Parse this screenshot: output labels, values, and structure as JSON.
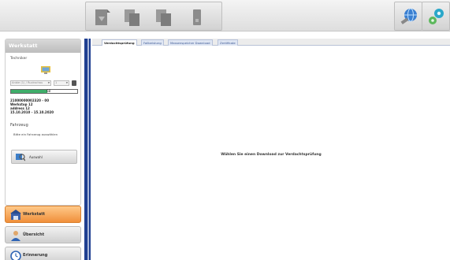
{
  "toolbar": {
    "buttons": [
      {
        "name": "download-icon"
      },
      {
        "name": "copy-icon"
      },
      {
        "name": "copy-alt-icon"
      },
      {
        "name": "card-icon"
      }
    ],
    "right_buttons": [
      {
        "name": "globe-connect-icon"
      },
      {
        "name": "settings-gears-icon"
      }
    ]
  },
  "werkstatt": {
    "title": "Werkstatt",
    "techniker_label": "Techniker",
    "dropdown1": "Anbie (1) / Ruckschau",
    "dropdown2": "1",
    "progress_percent": 55,
    "progress_text": "68",
    "info_lines": [
      "21000000002320 - 00",
      "Werkstop 12",
      "address 12",
      "15.10.2010 - 15.10.2020"
    ],
    "fahrzeug_label": "Fahrzeug",
    "fahrzeug_hint": "Bitte ein Fahrzeug auswählen",
    "auswahl_label": "Auswahl"
  },
  "nav": {
    "items": [
      {
        "label": "Werkstatt",
        "icon": "workshop-icon",
        "active": true
      },
      {
        "label": "Übersicht",
        "icon": "person-icon",
        "active": false
      },
      {
        "label": "Erinnerung",
        "icon": "clock-icon",
        "active": false
      }
    ]
  },
  "tabs": [
    {
      "label": "Verdachtsprüfung",
      "active": true
    },
    {
      "label": "Fallbeistung",
      "active": false
    },
    {
      "label": "Massenspeicher Download",
      "active": false
    },
    {
      "label": "Zertifikate",
      "active": false
    }
  ],
  "main": {
    "message": "Wählen Sie einen Download zur Verdachtsprüfung"
  },
  "colors": {
    "accent_blue": "#1f3f91",
    "active_nav": "#f08f3a",
    "progress_green": "#3fae6a"
  }
}
